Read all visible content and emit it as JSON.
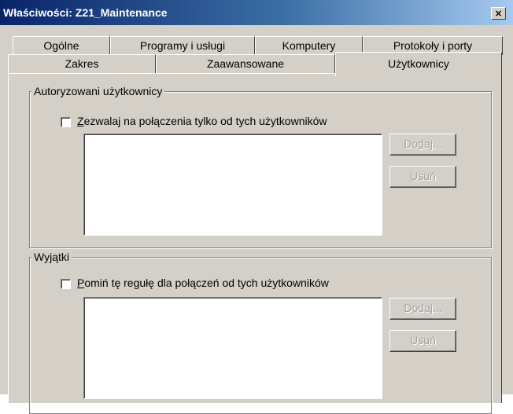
{
  "window": {
    "title": "Właściwości: Z21_Maintenance",
    "close_glyph": "×"
  },
  "tabs": {
    "row1": [
      {
        "label": "Ogólne"
      },
      {
        "label": "Programy i usługi"
      },
      {
        "label": "Komputery"
      },
      {
        "label": "Protokoły i porty"
      }
    ],
    "row2": [
      {
        "label": "Zakres"
      },
      {
        "label": "Zaawansowane"
      },
      {
        "label": "Użytkownicy",
        "active": true
      }
    ]
  },
  "authorized": {
    "group_label": "Autoryzowani użytkownicy",
    "checkbox": {
      "checked": false,
      "accel": "Z",
      "rest": "ezwalaj na połączenia tylko od tych użytkowników"
    },
    "add_button": {
      "pre": "Do",
      "accel": "d",
      "post": "aj...",
      "enabled": false
    },
    "remove_button": {
      "pre": "",
      "accel": "U",
      "post": "suń",
      "enabled": false
    }
  },
  "exceptions": {
    "group_label": "Wyjątki",
    "checkbox": {
      "checked": false,
      "accel": "P",
      "rest": "omiń tę regułę dla połączeń od tych użytkowników"
    },
    "add_button": {
      "pre": "D",
      "accel": "o",
      "post": "daj...",
      "enabled": false
    },
    "remove_button": {
      "pre": "Us",
      "accel": "u",
      "post": "ń",
      "enabled": false
    }
  },
  "colors": {
    "face": "#d4d0c8",
    "title_start": "#0a246a",
    "title_end": "#a6caf0",
    "disabled_text": "#a0a0a0"
  }
}
